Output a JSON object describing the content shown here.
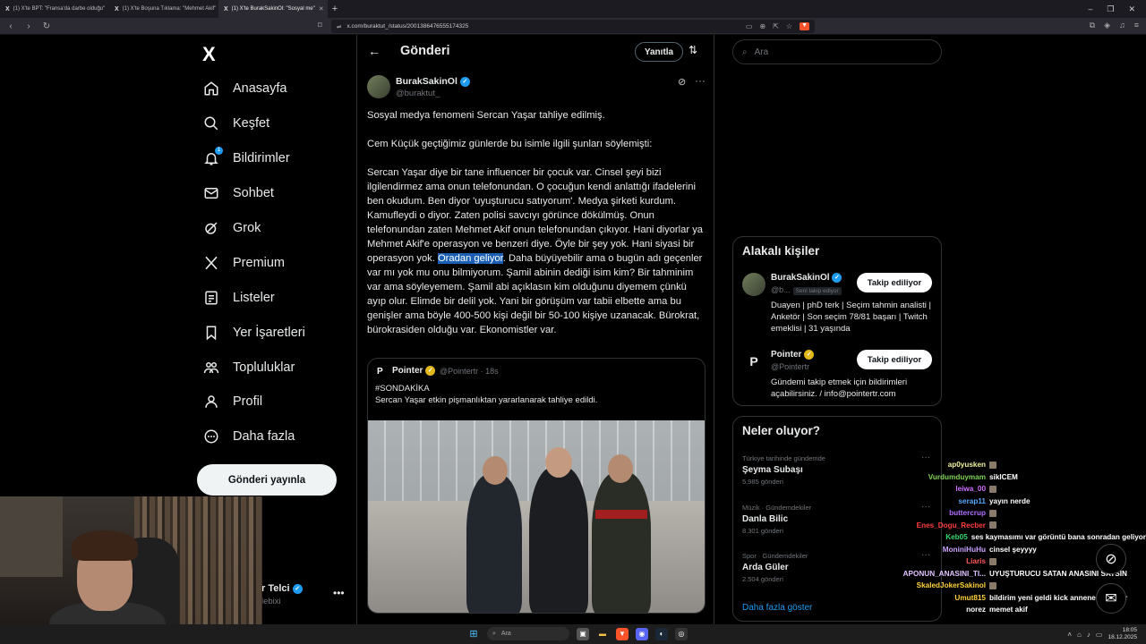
{
  "browser": {
    "tabs": [
      {
        "label": "(1) X'te BPT: \"Fransa'da darbe olduğu\"",
        "active": false
      },
      {
        "label": "(1) X'te Boşuna Tıklama: \"Mehmet Akif\"",
        "active": false
      },
      {
        "label": "(1) X'te BurakSakinOl: \"Sosyal me\"",
        "active": true
      }
    ],
    "url": "x.com/buraktut_/status/2001386476555174325"
  },
  "nav": {
    "logo": "X",
    "items": [
      {
        "label": "Anasayfa",
        "icon": "home-icon"
      },
      {
        "label": "Keşfet",
        "icon": "search-icon"
      },
      {
        "label": "Bildirimler",
        "icon": "bell-icon",
        "badge": "1"
      },
      {
        "label": "Sohbet",
        "icon": "mail-icon"
      },
      {
        "label": "Grok",
        "icon": "grok-icon"
      },
      {
        "label": "Premium",
        "icon": "x-icon"
      },
      {
        "label": "Listeler",
        "icon": "list-icon"
      },
      {
        "label": "Yer İşaretleri",
        "icon": "bookmark-icon"
      },
      {
        "label": "Topluluklar",
        "icon": "communities-icon"
      },
      {
        "label": "Profil",
        "icon": "profile-icon"
      },
      {
        "label": "Daha fazla",
        "icon": "more-circle-icon"
      }
    ],
    "post_button": "Gönderi yayınla",
    "account_name": "r Telci",
    "account_handle": "lebixi"
  },
  "header": {
    "title": "Gönderi",
    "reply_button": "Yanıtla"
  },
  "tweet": {
    "author": "BurakSakinOl",
    "handle": "@buraktut_",
    "p1": "Sosyal medya fenomeni Sercan Yaşar tahliye edilmiş.",
    "p2": "Cem Küçük geçtiğimiz günlerde bu isimle ilgili şunları söylemişti:",
    "p3_before": "Sercan Yaşar diye bir tane influencer bir çocuk var. Cinsel şeyi bizi ilgilendirmez ama onun telefonundan. O çocuğun kendi anlattığı ifadelerini ben okudum. Ben diyor 'uyuşturucu satıyorum'. Medya şirketi kurdum. Kamufleydi o diyor. Zaten polisi savcıyı görünce dökülmüş. Onun telefonundan zaten Mehmet Akif onun telefonundan çıkıyor. Hani diyorlar ya Mehmet Akif'e operasyon ve benzeri diye. Öyle bir şey yok. Hani siyasi bir operasyon yok. ",
    "p3_highlight": "Oradan geliyor",
    "p3_after": ". Daha büyüyebilir ama o bugün adı geçenler var mı yok mu onu bilmiyorum. Şamil abinin dediği isim kim? Bir tahminim var ama söyleyemem. Şamil abi açıklasın kim olduğunu diyemem çünkü ayıp olur. Elimde bir delil yok. Yani bir görüşüm var tabii elbette ama bu genişler ama böyle 400-500 kişi değil bir 50-100 kişiye uzanacak. Bürokrat, bürokrasiden olduğu var. Ekonomistler var."
  },
  "quote": {
    "name": "Pointer",
    "meta": "@Pointertr · 18s",
    "line1": "#SONDAKİKA",
    "line2": "Sercan Yaşar etkin pişmanlıktan yararlanarak tahliye edildi."
  },
  "search": {
    "placeholder": "Ara"
  },
  "related": {
    "title": "Alakalı kişiler",
    "people": [
      {
        "name": "BurakSakinOl",
        "handle": "@b...",
        "follows_you": "Seni takip ediyor",
        "button": "Takip ediliyor",
        "bio": "Duayen | phD terk | Seçim tahmin analisti | Anketör | Son seçim 78/81 başarı | Twitch emeklisi | 31 yaşında"
      },
      {
        "name": "Pointer",
        "handle": "@Pointertr",
        "button": "Takip ediliyor",
        "bio": "Gündemi takip etmek için bildirimleri açabilirsiniz. / info@pointertr.com"
      }
    ]
  },
  "trends": {
    "title": "Neler oluyor?",
    "items": [
      {
        "category": "Türkiye tarihinde gündemde",
        "name": "Şeyma Subaşı",
        "count": "5.985 gönderi"
      },
      {
        "category": "Müzik · Gündemdekiler",
        "name": "Danla Bilic",
        "count": "8.301 gönderi"
      },
      {
        "category": "Spor · Gündemdekiler",
        "name": "Arda Güler",
        "count": "2.504 gönderi"
      }
    ],
    "show_more": "Daha fazla göster"
  },
  "chat": [
    {
      "user": "ap0yusken",
      "color": "#f0f0a0",
      "text": ""
    },
    {
      "user": "Vurdumduymam",
      "color": "#7fd35a",
      "text": "sikICEM"
    },
    {
      "user": "leiwa_00",
      "color": "#d070ff",
      "text": ""
    },
    {
      "user": "serap11",
      "color": "#57a8ff",
      "text": "yayın nerde"
    },
    {
      "user": "buttercrup",
      "color": "#b070ff",
      "text": ""
    },
    {
      "user": "Enes_Dogu_Recber",
      "color": "#ff3d3d",
      "text": ""
    },
    {
      "user": "Keb05",
      "color": "#36d96f",
      "text": "ses kaymasımı var görüntü bana sonradan geliyor"
    },
    {
      "user": "MoniniHuHu",
      "color": "#c9a0ff",
      "text": "cinsel şeyyyy"
    },
    {
      "user": "Liaris",
      "color": "#ff5a5a",
      "text": ""
    },
    {
      "user": "APONUN_ANASINI_TI...",
      "color": "#e0c0ff",
      "text": "UYUŞTURUCU SATAN ANASINI SATSIN"
    },
    {
      "user": "SkaledJokerSakinol",
      "color": "#ffd23a",
      "text": ""
    },
    {
      "user": "Umut815",
      "color": "#ffd23a",
      "text": "bildirim yeni geldi kick annene selamlar"
    },
    {
      "user": "norez",
      "color": "#ffffff",
      "text": "memet akif"
    }
  ],
  "taskbar": {
    "search": "Ara",
    "time": "18:05",
    "date": "18.12.2025"
  }
}
